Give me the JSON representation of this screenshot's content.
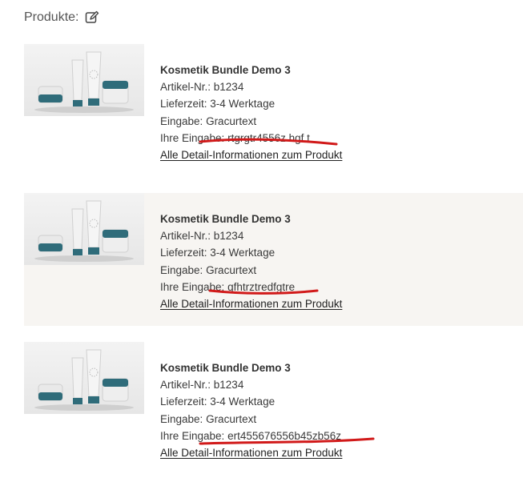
{
  "header": {
    "title": "Produkte:",
    "edit_icon": "edit-pencil-icon"
  },
  "products": [
    {
      "name": "Kosmetik Bundle Demo 3",
      "article_label": "Artikel-Nr.:",
      "article_value": "b1234",
      "delivery_label": "Lieferzeit:",
      "delivery_value": "3-4 Werktage",
      "input_label": "Eingabe:",
      "input_value": "Gracurtext",
      "user_input_label": "Ihre Eingabe:",
      "user_input_value": "rtgrgtr4556z hgf t",
      "detail_link": "Alle Detail-Informationen zum Produkt"
    },
    {
      "name": "Kosmetik Bundle Demo 3",
      "article_label": "Artikel-Nr.:",
      "article_value": "b1234",
      "delivery_label": "Lieferzeit:",
      "delivery_value": "3-4 Werktage",
      "input_label": "Eingabe:",
      "input_value": "Gracurtext",
      "user_input_label": "Ihre Eingabe:",
      "user_input_value": "gfhtrztredfgtre",
      "detail_link": "Alle Detail-Informationen zum Produkt"
    },
    {
      "name": "Kosmetik Bundle Demo 3",
      "article_label": "Artikel-Nr.:",
      "article_value": "b1234",
      "delivery_label": "Lieferzeit:",
      "delivery_value": "3-4 Werktage",
      "input_label": "Eingabe:",
      "input_value": "Gracurtext",
      "user_input_label": "Ihre Eingabe:",
      "user_input_value": "ert455676556b45zb56z",
      "detail_link": "Alle Detail-Informationen zum Produkt"
    }
  ],
  "colors": {
    "highlight_bg": "#f7f5f2",
    "annotation_red": "#d11a1a",
    "jar_teal": "#2f6c7a"
  }
}
